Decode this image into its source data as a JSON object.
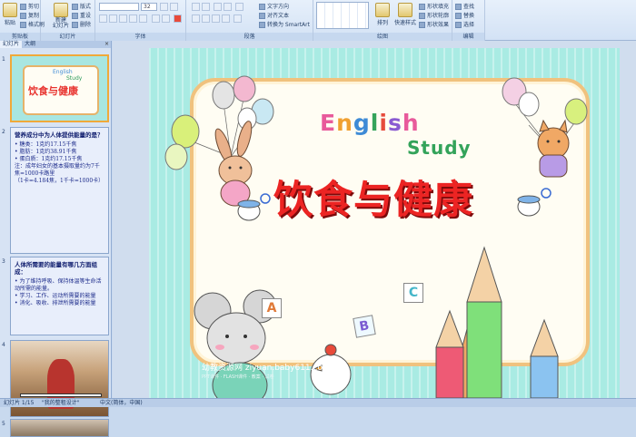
{
  "ribbon": {
    "clipboard": {
      "paste": "粘贴",
      "cut": "剪切",
      "copy": "复制",
      "format_painter": "格式刷",
      "label": "剪贴板"
    },
    "slides": {
      "new_slide": "新建\n幻灯片",
      "layout": "版式",
      "reset": "重设",
      "delete": "删除",
      "label": "幻灯片"
    },
    "font": {
      "font_name": "",
      "font_size": "32",
      "label": "字体"
    },
    "paragraph": {
      "text_direction": "文字方向",
      "align_text": "对齐文本",
      "convert_smartart": "转换为 SmartArt",
      "label": "段落"
    },
    "drawing": {
      "arrange": "排列",
      "quick_styles": "快速样式",
      "shape_fill": "形状填充",
      "shape_outline": "形状轮廓",
      "shape_effects": "形状效果",
      "label": "绘图"
    },
    "editing": {
      "find": "查找",
      "replace": "替换",
      "select": "选择",
      "label": "编辑"
    }
  },
  "pane": {
    "tabs": [
      "幻灯片",
      "大纲"
    ],
    "close": "×",
    "slide_numbers": [
      "1",
      "2",
      "3",
      "4",
      "5"
    ],
    "thumb1": {
      "title": "饮食与健康",
      "english": "English",
      "study": "Study"
    },
    "thumb2": {
      "heading": "营养成分中为人体提供能量的是？",
      "lines": [
        "• 糖类：1克约17.15千焦",
        "• 脂肪：1克约38.91千焦",
        "• 蛋白质：1克约17.15千焦",
        "",
        "注：成年妇女的基本摄取量约为7千焦=1000卡路里",
        "（1卡=4.184焦，1千卡=1000卡）"
      ]
    },
    "thumb3": {
      "heading": "人体所需要的能量有哪几方面组成：",
      "lines": [
        "• 为了维持呼吸、保持体温等生命活动所需的能量。",
        "• 学习、工作、运动所需要的能量",
        "• 消化、吸收、排泄所需要的能量"
      ]
    }
  },
  "slide": {
    "english": "English",
    "study": "Study",
    "title": "饮食与健康",
    "watermark": "幼教资源网 ziyuan.baby611.com",
    "watermark_sub": "PPT课件 · FLASH课件 · 教案 · 试卷",
    "blocks": [
      "A",
      "B",
      "C"
    ],
    "english_colors": [
      "#e85a9b",
      "#f0a030",
      "#3e8bd6",
      "#35a45b",
      "#e64b3c",
      "#8a5bd1",
      "#e85a9b"
    ]
  },
  "status": {
    "slide_info": "幻灯片 1/15",
    "theme": "\"我的整租设计\"",
    "language": "中文(简体，中国)"
  }
}
